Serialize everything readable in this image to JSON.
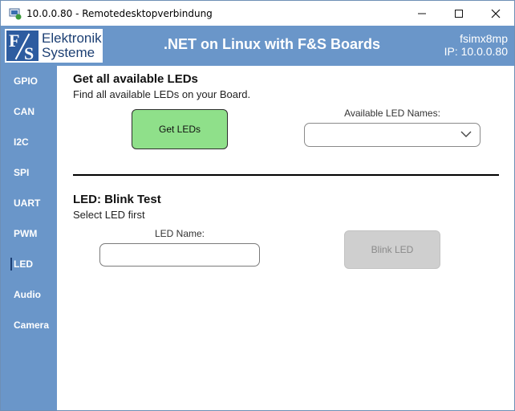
{
  "window": {
    "title": "10.0.0.80 - Remotedesktopverbindung",
    "controls": {
      "minimize": "—",
      "maximize": "☐",
      "close": "✕"
    }
  },
  "header": {
    "logo_line1": "Elektronik",
    "logo_line2": "Systeme",
    "logo_mark": {
      "left": "F",
      "right": "S"
    },
    "app_title": ".NET on Linux with F&S Boards",
    "host_name": "fsimx8mp",
    "host_ip": "IP: 10.0.0.80",
    "colors": {
      "accent": "#6a96c9",
      "logo_dark": "#2d5ca0"
    }
  },
  "sidebar": {
    "items": [
      {
        "label": "GPIO"
      },
      {
        "label": "CAN"
      },
      {
        "label": "I2C"
      },
      {
        "label": "SPI"
      },
      {
        "label": "UART"
      },
      {
        "label": "PWM"
      },
      {
        "label": "LED"
      },
      {
        "label": "Audio"
      },
      {
        "label": "Camera"
      }
    ],
    "active": "LED"
  },
  "get_leds": {
    "title": "Get all available LEDs",
    "subtitle": "Find all available LEDs on your Board.",
    "button_label": "Get LEDs",
    "names_label": "Available LED Names:",
    "selected_value": "",
    "colors": {
      "button": "#8fe08a"
    }
  },
  "blink": {
    "title": "LED: Blink Test",
    "subtitle": "Select LED first",
    "name_label": "LED Name:",
    "name_value": "",
    "button_label": "Blink LED",
    "colors": {
      "button_disabled": "#cfcfcf"
    }
  }
}
